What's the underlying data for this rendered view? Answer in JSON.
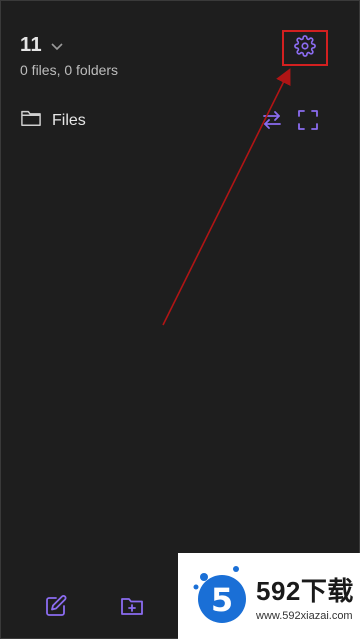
{
  "header": {
    "vault_name": "11",
    "vault_stats": "0 files, 0 folders"
  },
  "files_section": {
    "label": "Files"
  },
  "watermark": {
    "brand": "592下载",
    "url": "www.592xiazai.com"
  },
  "colors": {
    "background": "#1e1e1e",
    "accent": "#8b6cf0",
    "highlight_box": "#d32020",
    "annotation_arrow": "#b01515"
  },
  "icons": {
    "vault_dropdown": "chevron-down-icon",
    "settings": "gear-icon",
    "files": "folder-icon",
    "swap": "swap-arrows-icon",
    "expand": "expand-icon",
    "new_note": "new-note-icon",
    "new_folder": "new-folder-icon"
  }
}
